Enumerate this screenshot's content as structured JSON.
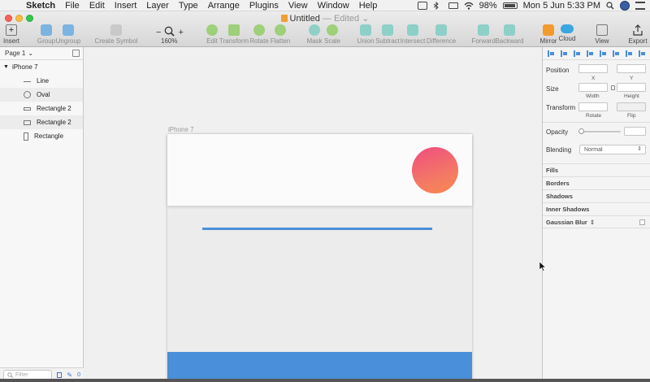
{
  "menubar": {
    "app_name": "Sketch",
    "items": [
      "File",
      "Edit",
      "Insert",
      "Layer",
      "Type",
      "Arrange",
      "Plugins",
      "View",
      "Window",
      "Help"
    ],
    "battery": "98%",
    "clock": "Mon 5 Jun  5:33 PM"
  },
  "window": {
    "title": "Untitled",
    "edited": "— Edited"
  },
  "toolbar": {
    "insert": "Insert",
    "group": "Group",
    "ungroup": "Ungroup",
    "create_symbol": "Create Symbol",
    "zoom_minus": "−",
    "zoom_plus": "+",
    "zoom_value": "160%",
    "edit": "Edit",
    "transform": "Transform",
    "rotate": "Rotate",
    "flatten": "Flatten",
    "mask": "Mask",
    "scale": "Scale",
    "union": "Union",
    "subtract": "Subtract",
    "intersect": "Intersect",
    "difference": "Difference",
    "forward": "Forward",
    "backward": "Backward",
    "mirror": "Mirror",
    "cloud": "Cloud",
    "view": "View",
    "export": "Export"
  },
  "layers": {
    "page": "Page 1",
    "artboard": "iPhone 7",
    "items": [
      "Line",
      "Oval",
      "Rectangle 2",
      "Rectangle 2",
      "Rectangle"
    ],
    "filter_placeholder": "Filter",
    "filter_count": "0"
  },
  "canvas": {
    "artboard_label": "iPhone 7"
  },
  "inspector": {
    "position": "Position",
    "x": "X",
    "y": "Y",
    "size": "Size",
    "width": "Width",
    "height": "Height",
    "transform": "Transform",
    "rotate": "Rotate",
    "flip": "Flip",
    "opacity": "Opacity",
    "blending": "Blending",
    "blending_value": "Normal",
    "sections": [
      "Fills",
      "Borders",
      "Shadows",
      "Inner Shadows",
      "Gaussian Blur"
    ]
  },
  "colors": {
    "accent_blue": "#4a8fd9",
    "oval_gradient_start": "#ef4d7f",
    "oval_gradient_end": "#f7894f"
  }
}
